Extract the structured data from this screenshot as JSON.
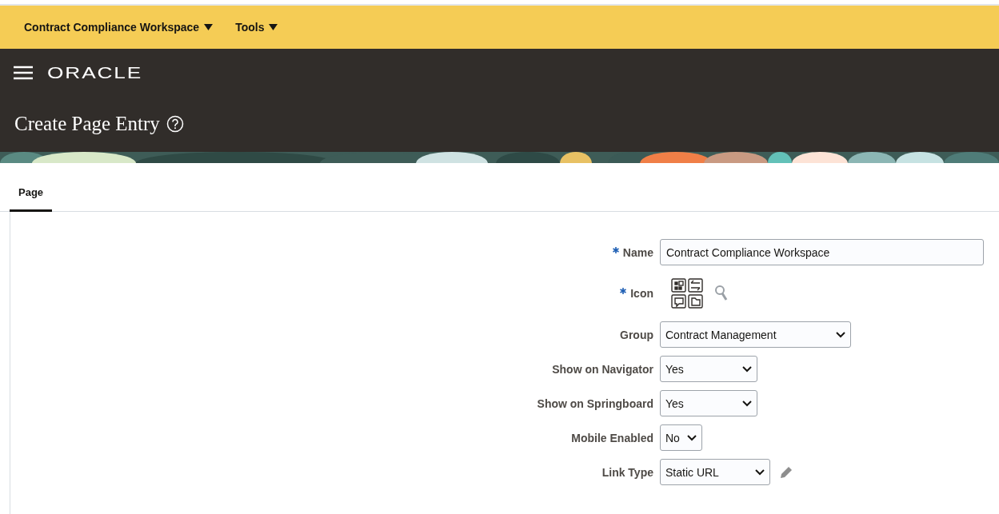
{
  "menu_bar": {
    "items": [
      {
        "label": "Contract Compliance Workspace"
      },
      {
        "label": "Tools"
      }
    ]
  },
  "header": {
    "logo": "ORACLE",
    "title": "Create Page Entry"
  },
  "tabs": [
    {
      "label": "Page",
      "selected": true
    }
  ],
  "form": {
    "fields": [
      {
        "kind": "text",
        "label": "Name",
        "required": true,
        "value": "Contract Compliance Workspace"
      },
      {
        "kind": "icon",
        "label": "Icon",
        "required": true
      },
      {
        "kind": "select",
        "label": "Group",
        "required": false,
        "value": "Contract Management"
      },
      {
        "kind": "select",
        "label": "Show on Navigator",
        "required": false,
        "value": "Yes"
      },
      {
        "kind": "select",
        "label": "Show on Springboard",
        "required": false,
        "value": "Yes"
      },
      {
        "kind": "select",
        "label": "Mobile Enabled",
        "required": false,
        "value": "No"
      },
      {
        "kind": "select",
        "label": "Link Type",
        "required": false,
        "value": "Static URL",
        "editable": true
      }
    ]
  }
}
